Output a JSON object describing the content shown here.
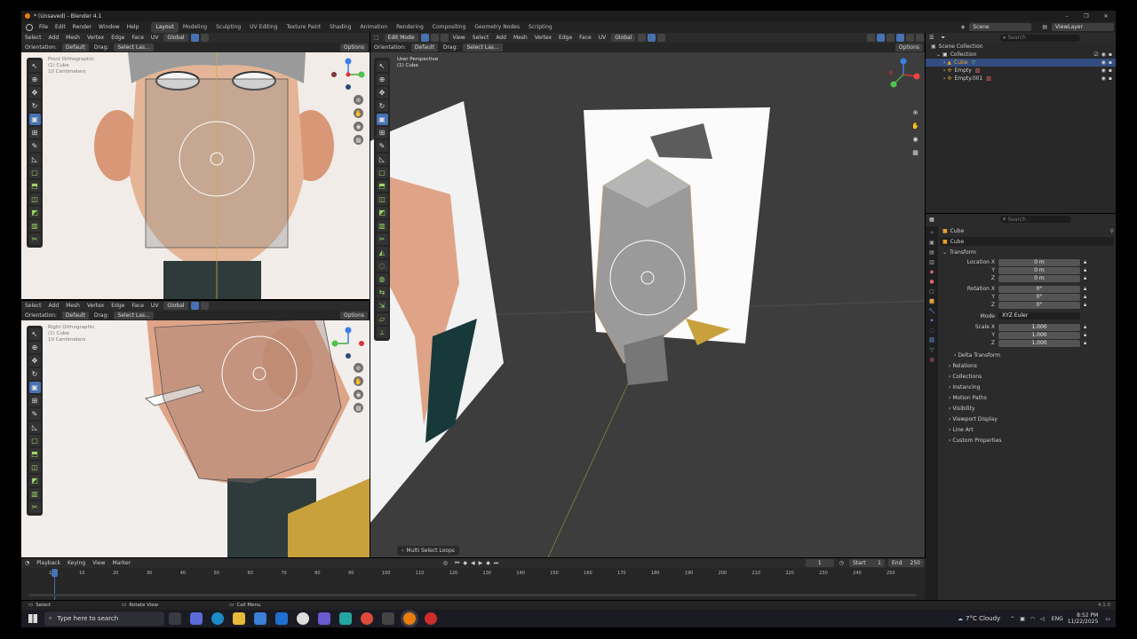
{
  "window": {
    "title": "* (Unsaved) - Blender 4.1"
  },
  "menus": [
    "File",
    "Edit",
    "Render",
    "Window",
    "Help"
  ],
  "workspaces": [
    "Layout",
    "Modeling",
    "Sculpting",
    "UV Editing",
    "Texture Paint",
    "Shading",
    "Animation",
    "Rendering",
    "Compositing",
    "Geometry Nodes",
    "Scripting"
  ],
  "scene_name": "Scene",
  "view_layer": "ViewLayer",
  "editor_menus_left": [
    "Select",
    "Add",
    "Mesh",
    "Vertex",
    "Edge",
    "Face",
    "UV"
  ],
  "editor_menus_main": [
    "View",
    "Select",
    "Add",
    "Mesh",
    "Vertex",
    "Edge",
    "Face",
    "UV"
  ],
  "mode": "Edit Mode",
  "transform_orientation": "Global",
  "orientation_label": "Orientation:",
  "orientation_value": "Default",
  "drag_label": "Drag:",
  "drag_value": "Select Lasso",
  "drag_value_short": "Select Las...",
  "options_label": "Options",
  "viewports": {
    "front": {
      "view": "Front Orthographic",
      "object": "(1) Cube",
      "units": "10 Centimeters"
    },
    "right": {
      "view": "Right Orthographic",
      "object": "(1) Cube",
      "units": "10 Centimeters"
    },
    "main": {
      "view": "User Perspective",
      "object": "(1) Cube"
    }
  },
  "last_operator": "Multi Select Loops",
  "outliner": {
    "search_placeholder": "Search",
    "items": [
      {
        "label": "Scene Collection"
      },
      {
        "label": "Collection"
      },
      {
        "label": "Cube"
      },
      {
        "label": "Empty"
      },
      {
        "label": "Empty.001"
      }
    ]
  },
  "properties": {
    "search_placeholder": "Search",
    "object_name": "Cube",
    "datablock_name": "Cube",
    "transform_label": "Transform",
    "location_label": "Location X",
    "rotation_label": "Rotation X",
    "scale_label": "Scale X",
    "y_label": "Y",
    "z_label": "Z",
    "location": [
      "0 m",
      "0 m",
      "0 m"
    ],
    "rotation": [
      "0°",
      "0°",
      "0°"
    ],
    "mode_label": "Mode",
    "mode_value": "XYZ Euler",
    "scale": [
      "1.000",
      "1.000",
      "1.000"
    ],
    "delta_transform": "Delta Transform",
    "subpanels": [
      "Relations",
      "Collections",
      "Instancing",
      "Motion Paths",
      "Visibility",
      "Viewport Display",
      "Line Art",
      "Custom Properties"
    ]
  },
  "timeline": {
    "menus": [
      "Playback",
      "Keying",
      "View",
      "Marker"
    ],
    "current_frame": "1",
    "start_label": "Start",
    "start": "1",
    "end_label": "End",
    "end": "250",
    "ruler": [
      "1",
      "10",
      "20",
      "30",
      "40",
      "50",
      "60",
      "70",
      "80",
      "90",
      "100",
      "110",
      "120",
      "130",
      "140",
      "150",
      "160",
      "170",
      "180",
      "190",
      "200",
      "210",
      "220",
      "230",
      "240",
      "250"
    ]
  },
  "status_bar": {
    "select": "Select",
    "rotate": "Rotate View",
    "call_menu": "Call Menu",
    "version": "4.1.0"
  },
  "taskbar": {
    "search_placeholder": "Type here to search",
    "weather": "7°C  Cloudy",
    "lang": "ENG",
    "time": "8:52 PM",
    "date": "11/22/2025"
  },
  "colors": {
    "accent": "#4772b3",
    "active_orange": "#e7a02a",
    "header": "#2b2b2b",
    "viewport": "#3d3d3d"
  }
}
